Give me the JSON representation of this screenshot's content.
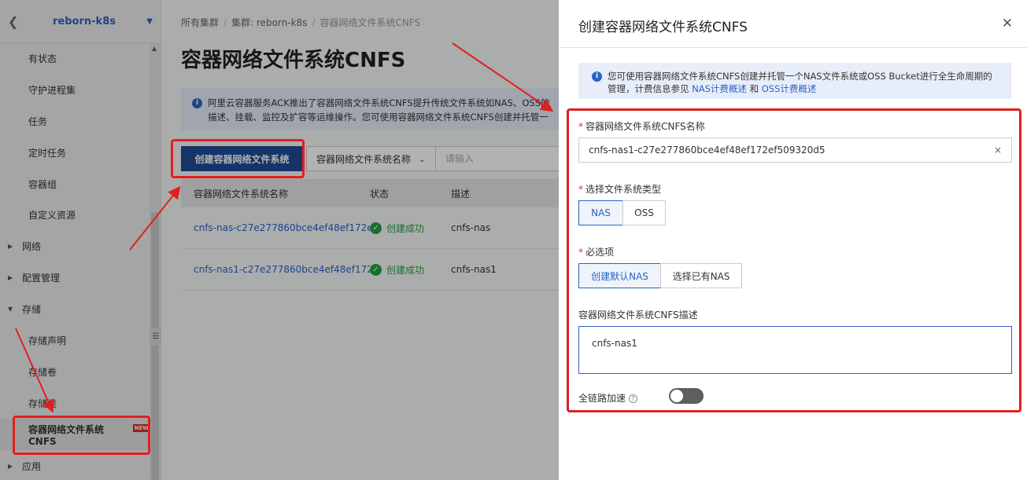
{
  "sidebar": {
    "cluster_name": "reborn-k8s",
    "items": [
      {
        "label": "有状态",
        "type": "sub"
      },
      {
        "label": "守护进程集",
        "type": "sub"
      },
      {
        "label": "任务",
        "type": "sub"
      },
      {
        "label": "定时任务",
        "type": "sub"
      },
      {
        "label": "容器组",
        "type": "sub"
      },
      {
        "label": "自定义资源",
        "type": "sub"
      },
      {
        "label": "网络",
        "type": "group-collapsed"
      },
      {
        "label": "配置管理",
        "type": "group-collapsed"
      },
      {
        "label": "存储",
        "type": "group-expanded"
      },
      {
        "label": "存储声明",
        "type": "sub"
      },
      {
        "label": "存储卷",
        "type": "sub"
      },
      {
        "label": "存储类",
        "type": "sub"
      },
      {
        "label": "容器网络文件系统CNFS",
        "type": "sub-active",
        "badge": "NEW"
      },
      {
        "label": "应用",
        "type": "group-collapsed"
      }
    ]
  },
  "breadcrumb": {
    "root": "所有集群",
    "cluster": "集群:  reborn-k8s",
    "current": "容器网络文件系统CNFS"
  },
  "main": {
    "title": "容器网络文件系统CNFS",
    "info_line1": "阿里云容器服务ACK推出了容器网络文件系统CNFS提升传统文件系统如NAS、OSS的",
    "info_line2": "描述、挂载、监控及扩容等运维操作。您可使用容器网络文件系统CNFS创建并托管一",
    "create_button": "创建容器网络文件系统",
    "filter_select": "容器网络文件系统名称",
    "search_placeholder": "请输入",
    "table": {
      "headers": [
        "容器网络文件系统名称",
        "状态",
        "描述"
      ],
      "rows": [
        {
          "name": "cnfs-nas-c27e277860bce4ef48ef172ef...",
          "status": "创建成功",
          "desc": "cnfs-nas"
        },
        {
          "name": "cnfs-nas1-c27e277860bce4ef48ef172ef...",
          "status": "创建成功",
          "desc": "cnfs-nas1"
        }
      ]
    }
  },
  "drawer": {
    "title": "创建容器网络文件系统CNFS",
    "info_text1": "您可使用容器网络文件系统CNFS创建并托管一个NAS文件系统或OSS Bucket进行全生命周期的",
    "info_text2": "管理，计费信息参见",
    "info_link1": "NAS计费概述",
    "info_and": "和",
    "info_link2": "OSS计费概述",
    "name_label": "容器网络文件系统CNFS名称",
    "name_value": "cnfs-nas1-c27e277860bce4ef48ef172ef509320d5",
    "type_label": "选择文件系统类型",
    "type_options": [
      "NAS",
      "OSS"
    ],
    "type_selected": "NAS",
    "required_label": "必选项",
    "required_options": [
      "创建默认NAS",
      "选择已有NAS"
    ],
    "required_selected": "创建默认NAS",
    "desc_label": "容器网络文件系统CNFS描述",
    "desc_value": "cnfs-nas1",
    "accel_label": "全链路加速",
    "accel_enabled": false
  },
  "colors": {
    "primary": "#1f4b99",
    "link": "#2b63c6",
    "success": "#23a144",
    "annotation": "#e02020"
  }
}
